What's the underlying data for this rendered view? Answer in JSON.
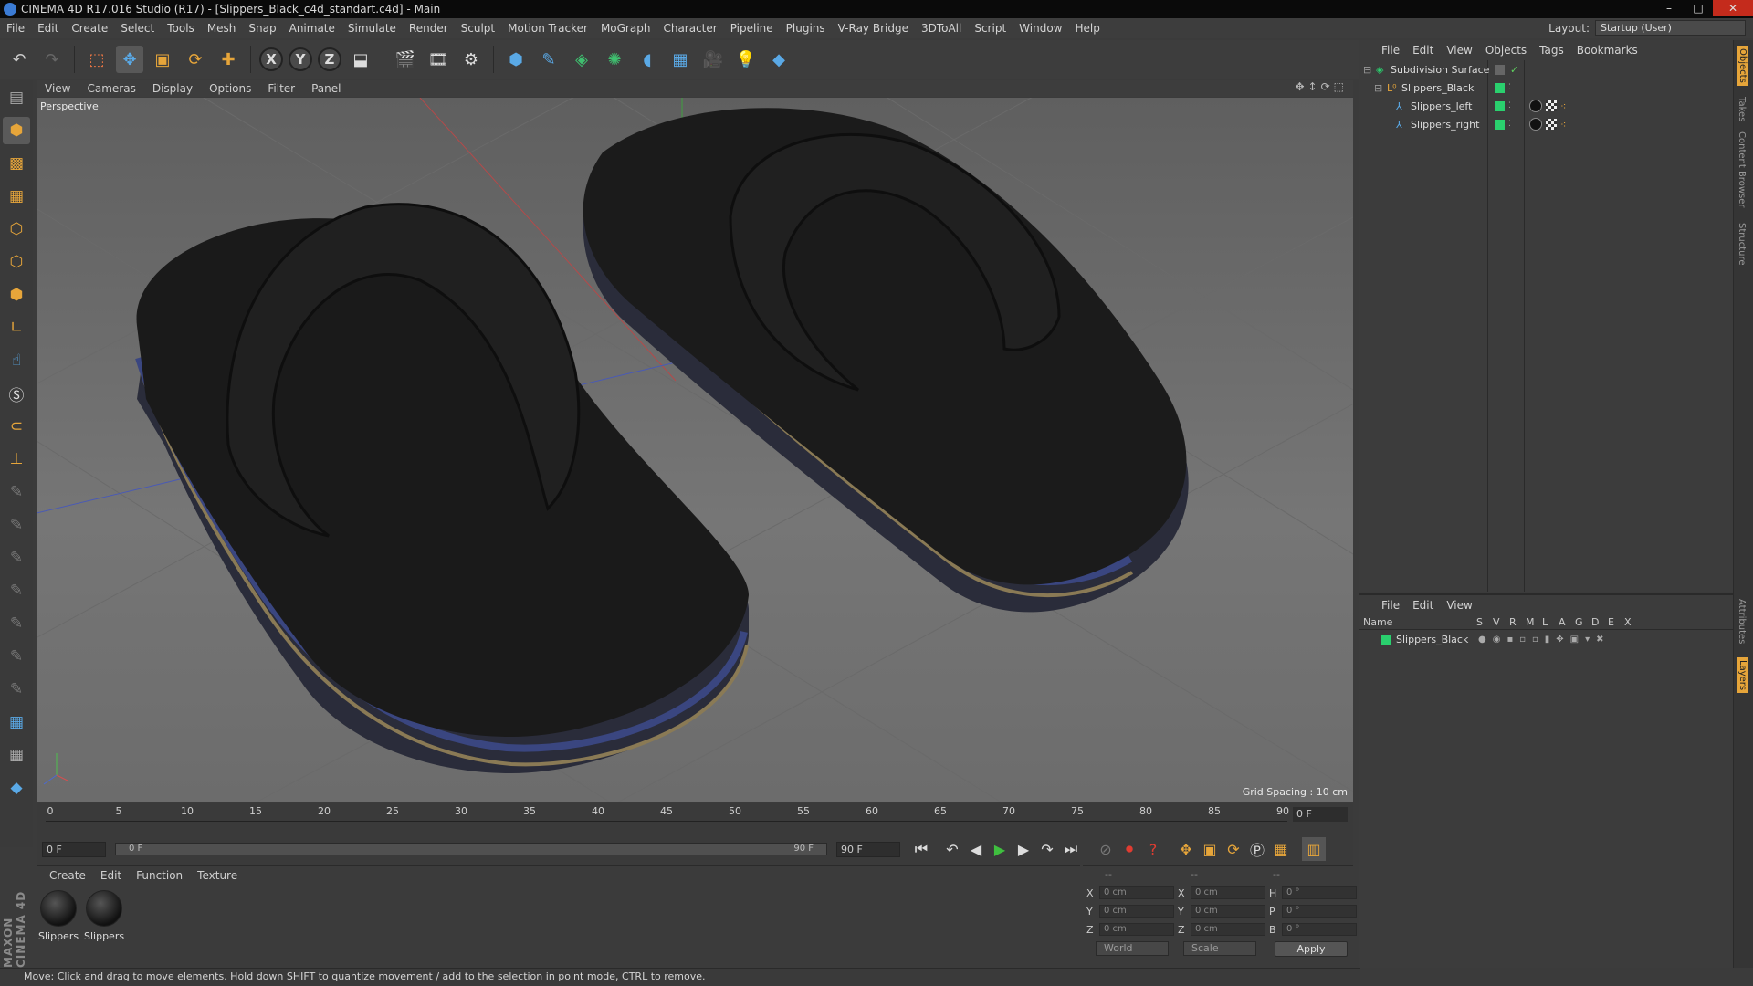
{
  "window": {
    "title": "CINEMA 4D R17.016 Studio (R17) - [Slippers_Black_c4d_standart.c4d] - Main"
  },
  "menu": [
    "File",
    "Edit",
    "Create",
    "Select",
    "Tools",
    "Mesh",
    "Snap",
    "Animate",
    "Simulate",
    "Render",
    "Sculpt",
    "Motion Tracker",
    "MoGraph",
    "Character",
    "Pipeline",
    "Plugins",
    "V-Ray Bridge",
    "3DToAll",
    "Script",
    "Window",
    "Help"
  ],
  "layout": {
    "label": "Layout:",
    "value": "Startup (User)"
  },
  "viewport": {
    "menu": [
      "View",
      "Cameras",
      "Display",
      "Options",
      "Filter",
      "Panel"
    ],
    "camera_label": "Perspective",
    "grid_spacing": "Grid Spacing : 10 cm"
  },
  "timeline": {
    "ticks": [
      "0",
      "5",
      "10",
      "15",
      "20",
      "25",
      "30",
      "35",
      "40",
      "45",
      "50",
      "55",
      "60",
      "65",
      "70",
      "75",
      "80",
      "85",
      "90"
    ],
    "current_frame": "0 F",
    "start_frame": "0 F",
    "range_start": "0 F",
    "range_end": "90 F",
    "end_frame": "90 F"
  },
  "materials": {
    "menu": [
      "Create",
      "Edit",
      "Function",
      "Texture"
    ],
    "items": [
      "Slippers",
      "Slippers"
    ]
  },
  "coords": {
    "headers": [
      "--",
      "--",
      "--"
    ],
    "rows": [
      {
        "l1": "X",
        "v1": "0 cm",
        "l2": "X",
        "v2": "0 cm",
        "l3": "H",
        "v3": "0 °"
      },
      {
        "l1": "Y",
        "v1": "0 cm",
        "l2": "Y",
        "v2": "0 cm",
        "l3": "P",
        "v3": "0 °"
      },
      {
        "l1": "Z",
        "v1": "0 cm",
        "l2": "Z",
        "v2": "0 cm",
        "l3": "B",
        "v3": "0 °"
      }
    ],
    "space": "World",
    "mode": "Scale",
    "apply": "Apply"
  },
  "status": "Move: Click and drag to move elements. Hold down SHIFT to quantize movement / add to the selection in point mode, CTRL to remove.",
  "objects": {
    "menu": [
      "File",
      "Edit",
      "View",
      "Objects",
      "Tags",
      "Bookmarks"
    ],
    "items": [
      {
        "name": "Subdivision Surface",
        "level": 0
      },
      {
        "name": "Slippers_Black",
        "level": 1
      },
      {
        "name": "Slippers_left",
        "level": 2
      },
      {
        "name": "Slippers_right",
        "level": 2
      }
    ]
  },
  "layers": {
    "menu": [
      "File",
      "Edit",
      "View"
    ],
    "columns": [
      "Name",
      "S",
      "V",
      "R",
      "M",
      "L",
      "A",
      "G",
      "D",
      "E",
      "X"
    ],
    "items": [
      "Slippers_Black"
    ]
  },
  "side_tabs": [
    "Objects",
    "Takes",
    "Content Browser",
    "Structure",
    "Attributes",
    "Layers"
  ],
  "colors": {
    "accent": "#e6a53a",
    "layer_green": "#2ad06e"
  }
}
